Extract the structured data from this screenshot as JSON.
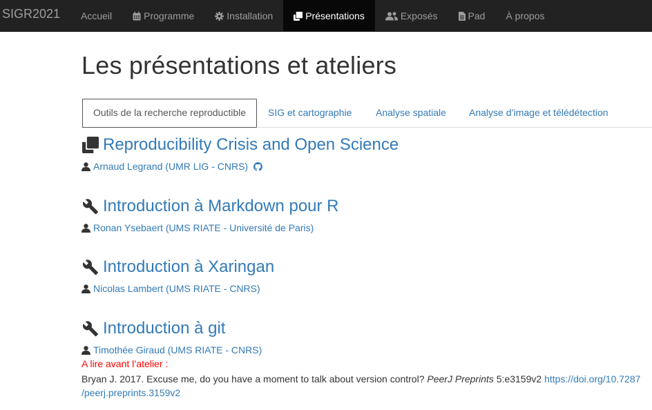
{
  "navbar": {
    "brand": "SIGR2021",
    "items": [
      {
        "label": "Accueil",
        "icon": "",
        "active": false
      },
      {
        "label": "Programme",
        "icon": "calendar-icon",
        "active": false
      },
      {
        "label": "Installation",
        "icon": "gear-icon",
        "active": false
      },
      {
        "label": "Présentations",
        "icon": "clone-icon",
        "active": true
      },
      {
        "label": "Exposés",
        "icon": "users-icon",
        "active": false
      },
      {
        "label": "Pad",
        "icon": "file-icon",
        "active": false
      },
      {
        "label": "À propos",
        "icon": "",
        "active": false
      }
    ]
  },
  "page": {
    "title": "Les présentations et ateliers"
  },
  "tabs": [
    {
      "label": "Outils de la recherche reproductible",
      "active": true
    },
    {
      "label": "SIG et cartographie",
      "active": false
    },
    {
      "label": "Analyse spatiale",
      "active": false
    },
    {
      "label": "Analyse d’image et télédétection",
      "active": false
    }
  ],
  "items": [
    {
      "icon": "clone-icon",
      "title": "Reproducibility Crisis and Open Science",
      "author": "Arnaud Legrand (UMR LIG - CNRS)",
      "github": true
    },
    {
      "icon": "wrench-icon",
      "title": "Introduction à Markdown pour R",
      "author": "Ronan Ysebaert (UMS RIATE - Université de Paris)",
      "github": false
    },
    {
      "icon": "wrench-icon",
      "title": "Introduction à Xaringan",
      "author": "Nicolas Lambert (UMS RIATE - CNRS)",
      "github": false
    },
    {
      "icon": "wrench-icon",
      "title": "Introduction à git",
      "author": "Timothée Giraud (UMS RIATE - CNRS)",
      "github": false
    }
  ],
  "git_note": {
    "warning": "A lire avant l’atelier :",
    "ref_text": "Bryan J. 2017. Excuse me, do you have a moment to talk about version control?",
    "journal": "PeerJ Preprints",
    "ref_id": "5:e3159v2",
    "link_line1": "https://doi.org/10.7287",
    "link_line2": "/peerj.preprints.3159v2"
  },
  "colors": {
    "navbar_bg": "#222222",
    "navbar_active_bg": "#080808",
    "link": "#337ab7",
    "warning": "#ff0000",
    "text": "#333333"
  }
}
